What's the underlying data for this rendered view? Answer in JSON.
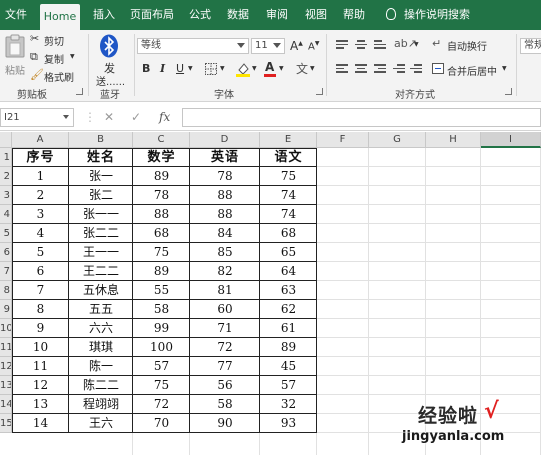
{
  "menu": {
    "tabs": [
      "文件",
      "Home",
      "插入",
      "页面布局",
      "公式",
      "数据",
      "审阅",
      "视图",
      "帮助"
    ],
    "active_tab": "Home",
    "tell_me": "操作说明搜索"
  },
  "ribbon": {
    "clipboard": {
      "paste": "粘贴",
      "cut": "剪切",
      "copy": "复制",
      "format_painter": "格式刷",
      "label": "剪贴板"
    },
    "bluetooth": {
      "send": "发",
      "send_sub": "送......",
      "label": "蓝牙"
    },
    "font": {
      "name": "等线",
      "size": "11",
      "bold": "B",
      "italic": "I",
      "underline": "U",
      "font_color_glyph": "A",
      "grow": "A",
      "shrink": "A",
      "label": "字体"
    },
    "alignment": {
      "wrap_text": "自动换行",
      "merge_center": "合并后居中",
      "label": "对齐方式"
    },
    "number": {
      "format": "常规"
    }
  },
  "formula_bar": {
    "name_box": "I21",
    "cancel": "✕",
    "enter": "✓",
    "fx": "fx",
    "value": ""
  },
  "grid": {
    "columns": [
      "A",
      "B",
      "C",
      "D",
      "E",
      "F",
      "G",
      "H",
      "I"
    ],
    "selected_column": "I",
    "row_numbers": [
      "1",
      "2",
      "3",
      "4",
      "5",
      "6",
      "7",
      "8",
      "9",
      "10",
      "11",
      "12",
      "13",
      "14",
      "15"
    ],
    "table": {
      "headers": [
        "序号",
        "姓名",
        "数学",
        "英语",
        "语文"
      ],
      "rows": [
        [
          "1",
          "张一",
          "89",
          "78",
          "75"
        ],
        [
          "2",
          "张二",
          "78",
          "88",
          "74"
        ],
        [
          "3",
          "张一一",
          "88",
          "88",
          "74"
        ],
        [
          "4",
          "张二二",
          "68",
          "84",
          "68"
        ],
        [
          "5",
          "王一一",
          "75",
          "85",
          "65"
        ],
        [
          "6",
          "王二二",
          "89",
          "82",
          "64"
        ],
        [
          "7",
          "五休息",
          "55",
          "81",
          "63"
        ],
        [
          "8",
          "五五",
          "58",
          "60",
          "62"
        ],
        [
          "9",
          "六六",
          "99",
          "71",
          "61"
        ],
        [
          "10",
          "琪琪",
          "100",
          "72",
          "89"
        ],
        [
          "11",
          "陈一",
          "57",
          "77",
          "45"
        ],
        [
          "12",
          "陈二二",
          "75",
          "56",
          "57"
        ],
        [
          "13",
          "程翊翊",
          "72",
          "58",
          "32"
        ],
        [
          "14",
          "王六",
          "70",
          "90",
          "93"
        ]
      ]
    }
  },
  "watermark": {
    "main": "经验啦",
    "check": "√",
    "sub": "jingyanla.com"
  },
  "colors": {
    "excel_green": "#217346",
    "watermark_check": "#e02020"
  }
}
